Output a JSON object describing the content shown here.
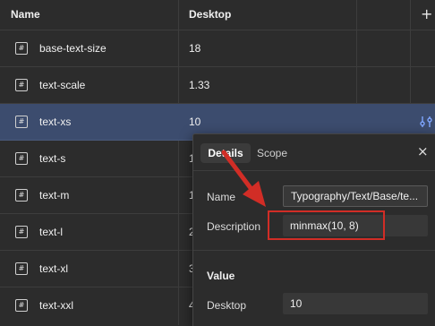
{
  "table": {
    "columns": {
      "name": "Name",
      "desktop": "Desktop"
    },
    "add_label": "+",
    "rows": [
      {
        "name": "base-text-size",
        "value": "18"
      },
      {
        "name": "text-scale",
        "value": "1.33"
      },
      {
        "name": "text-xs",
        "value": "10"
      },
      {
        "name": "text-s",
        "value": "1"
      },
      {
        "name": "text-m",
        "value": "1"
      },
      {
        "name": "text-l",
        "value": "2"
      },
      {
        "name": "text-xl",
        "value": "3"
      },
      {
        "name": "text-xxl",
        "value": "4"
      }
    ],
    "row_icon": "#",
    "selected_row_action_icon": "adjust-variable-icon"
  },
  "panel": {
    "tabs": {
      "details": "Details",
      "scope": "Scope"
    },
    "close_icon": "×",
    "name_label": "Name",
    "name_value": "Typography/Text/Base/te...",
    "description_label": "Description",
    "description_value": "minmax(10, 8)",
    "value_section": "Value",
    "desktop_label": "Desktop",
    "desktop_value": "10"
  },
  "colors": {
    "background": "#2c2c2c",
    "selected_row": "#3c4c6e",
    "annotation_red": "#d12d26"
  }
}
